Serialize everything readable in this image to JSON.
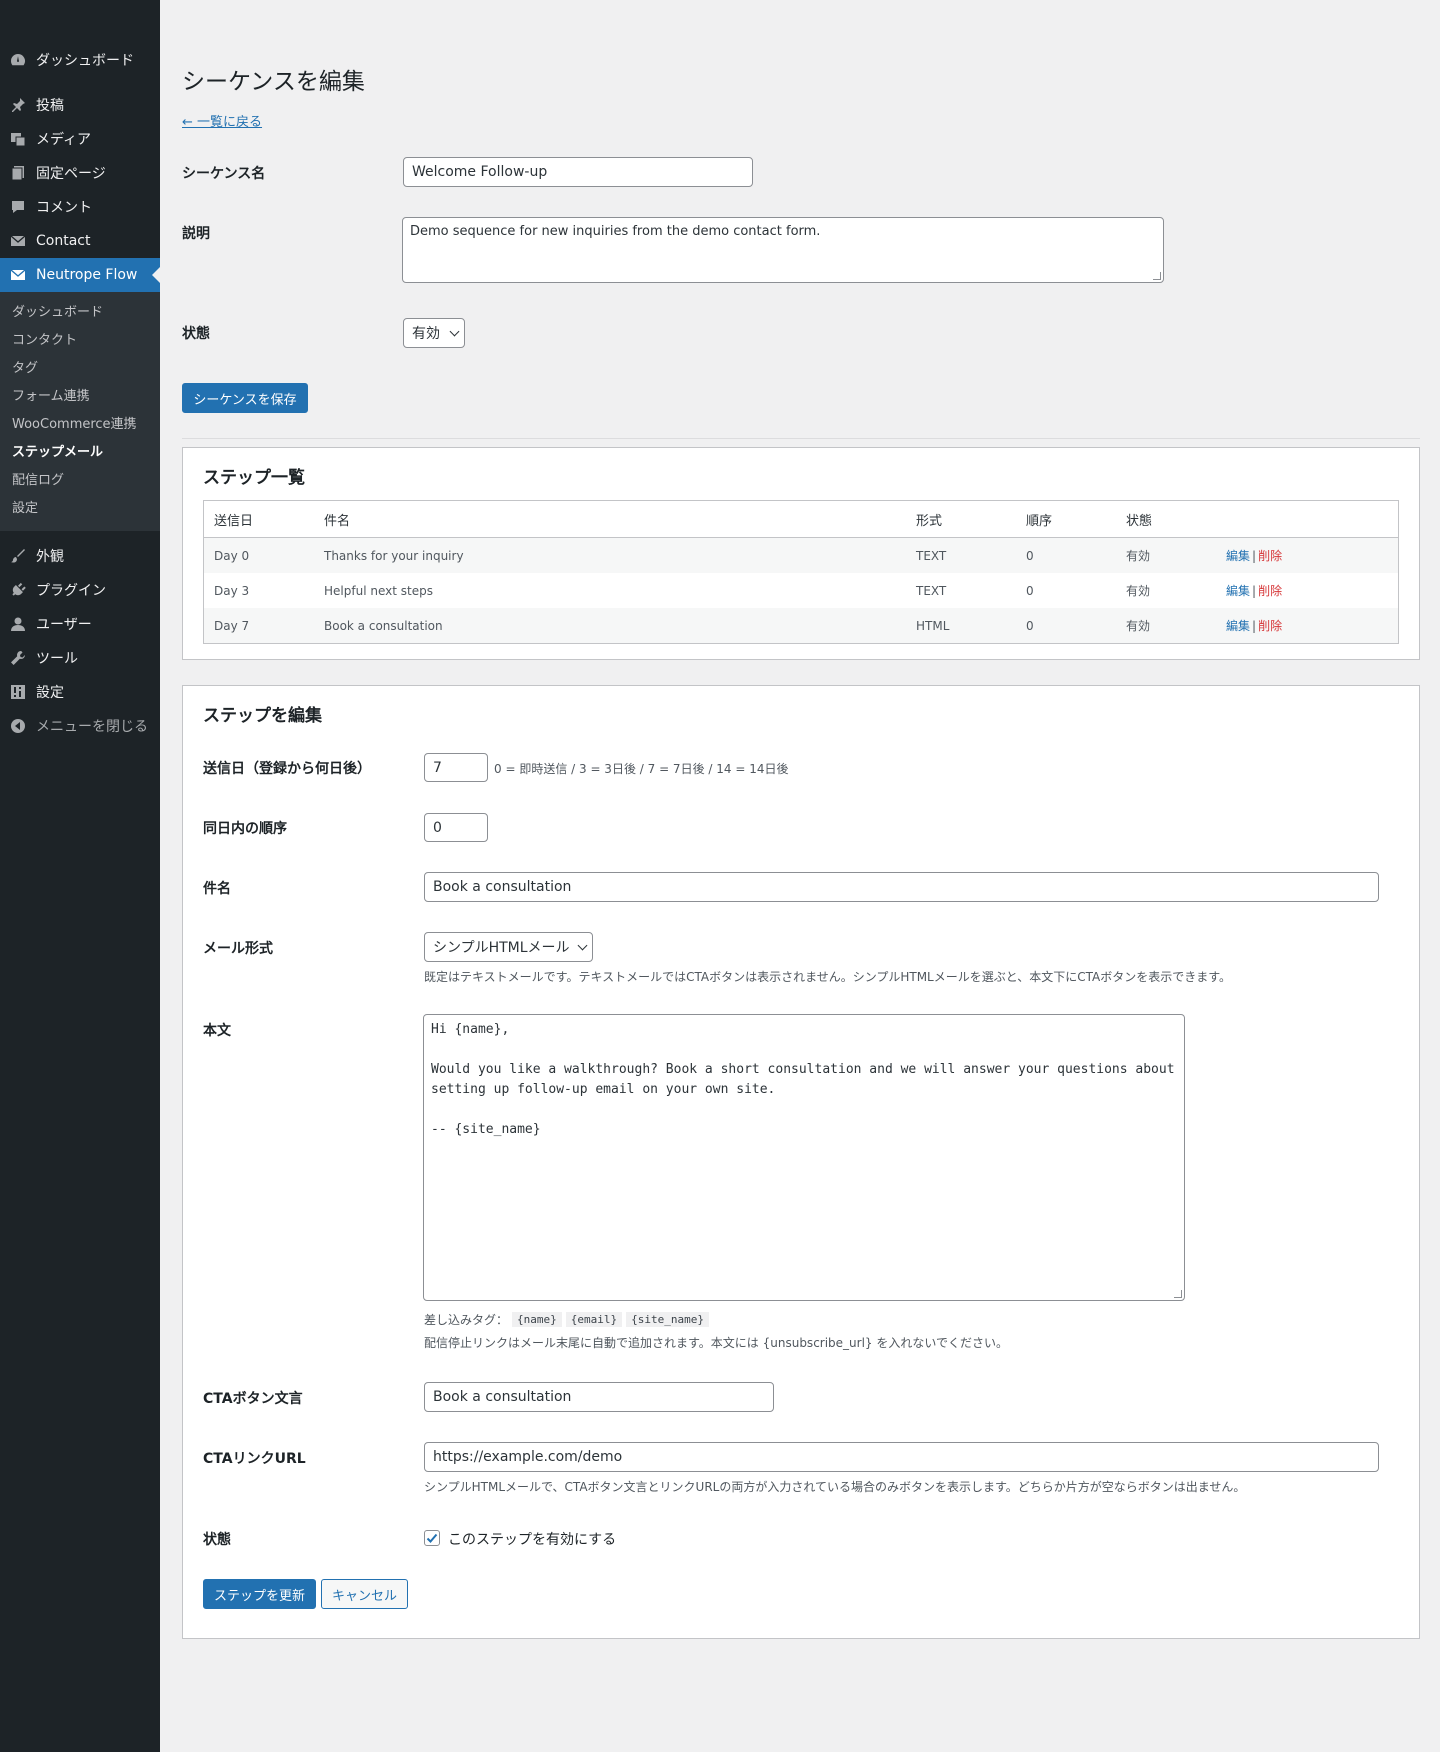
{
  "sidebar": {
    "top_items": [
      {
        "label": "ダッシュボード",
        "icon": "dashboard-icon"
      },
      {
        "label": "投稿",
        "icon": "pin-icon"
      },
      {
        "label": "メディア",
        "icon": "media-icon"
      },
      {
        "label": "固定ページ",
        "icon": "page-icon"
      },
      {
        "label": "コメント",
        "icon": "comment-icon"
      },
      {
        "label": "Contact",
        "icon": "mail-icon"
      },
      {
        "label": "Neutrope Flow",
        "icon": "mail-icon"
      }
    ],
    "submenu": [
      "ダッシュボード",
      "コンタクト",
      "タグ",
      "フォーム連携",
      "WooCommerce連携",
      "ステップメール",
      "配信ログ",
      "設定"
    ],
    "bottom_items": [
      {
        "label": "外観",
        "icon": "brush-icon"
      },
      {
        "label": "プラグイン",
        "icon": "plug-icon"
      },
      {
        "label": "ユーザー",
        "icon": "user-icon"
      },
      {
        "label": "ツール",
        "icon": "wrench-icon"
      },
      {
        "label": "設定",
        "icon": "settings-icon"
      },
      {
        "label": "メニューを閉じる",
        "icon": "collapse-icon"
      }
    ]
  },
  "page": {
    "title": "シーケンスを編集",
    "back_link": "← 一覧に戻る",
    "sequence_name_label": "シーケンス名",
    "sequence_name_value": "Welcome Follow-up",
    "description_label": "説明",
    "description_value": "Demo sequence for new inquiries from the demo contact form.",
    "status_label": "状態",
    "status_value": "有効",
    "save_button": "シーケンスを保存"
  },
  "steps_list": {
    "title": "ステップ一覧",
    "columns": [
      "送信日",
      "件名",
      "形式",
      "順序",
      "状態"
    ],
    "rows": [
      {
        "day": "Day 0",
        "subject": "Thanks for your inquiry",
        "format": "TEXT",
        "order": "0",
        "status": "有効",
        "edit": "編集",
        "sep": "|",
        "delete": "削除"
      },
      {
        "day": "Day 3",
        "subject": "Helpful next steps",
        "format": "TEXT",
        "order": "0",
        "status": "有効",
        "edit": "編集",
        "sep": "|",
        "delete": "削除"
      },
      {
        "day": "Day 7",
        "subject": "Book a consultation",
        "format": "HTML",
        "order": "0",
        "status": "有効",
        "edit": "編集",
        "sep": "|",
        "delete": "削除"
      }
    ]
  },
  "step_edit": {
    "title": "ステップを編集",
    "send_day_label": "送信日（登録から何日後）",
    "send_day_value": "7",
    "send_day_hint": "0 = 即時送信 / 3 = 3日後 / 7 = 7日後 / 14 = 14日後",
    "order_label": "同日内の順序",
    "order_value": "0",
    "subject_label": "件名",
    "subject_value": "Book a consultation",
    "format_label": "メール形式",
    "format_value": "シンプルHTMLメール",
    "format_hint": "既定はテキストメールです。テキストメールではCTAボタンは表示されません。シンプルHTMLメールを選ぶと、本文下にCTAボタンを表示できます。",
    "body_label": "本文",
    "body_value": "Hi {name},\n\nWould you like a walkthrough? Book a short consultation and we will answer your questions about\nsetting up follow-up email on your own site.\n\n-- {site_name}",
    "merge_tags_label": "差し込みタグ：",
    "merge_tags": [
      "{name}",
      "{email}",
      "{site_name}"
    ],
    "unsubscribe_hint": "配信停止リンクはメール末尾に自動で追加されます。本文には {unsubscribe_url} を入れないでください。",
    "cta_text_label": "CTAボタン文言",
    "cta_text_value": "Book a consultation",
    "cta_url_label": "CTAリンクURL",
    "cta_url_value": "https://example.com/demo",
    "cta_url_hint": "シンプルHTMLメールで、CTAボタン文言とリンクURLの両方が入力されている場合のみボタンを表示します。どちらか片方が空ならボタンは出ません。",
    "status_label": "状態",
    "status_checkbox_label": "このステップを有効にする",
    "status_checked": true,
    "update_button": "ステップを更新",
    "cancel_button": "キャンセル"
  },
  "colors": {
    "sidebar_bg": "#1d2327",
    "accent": "#2271b1",
    "delete": "#d63638"
  }
}
